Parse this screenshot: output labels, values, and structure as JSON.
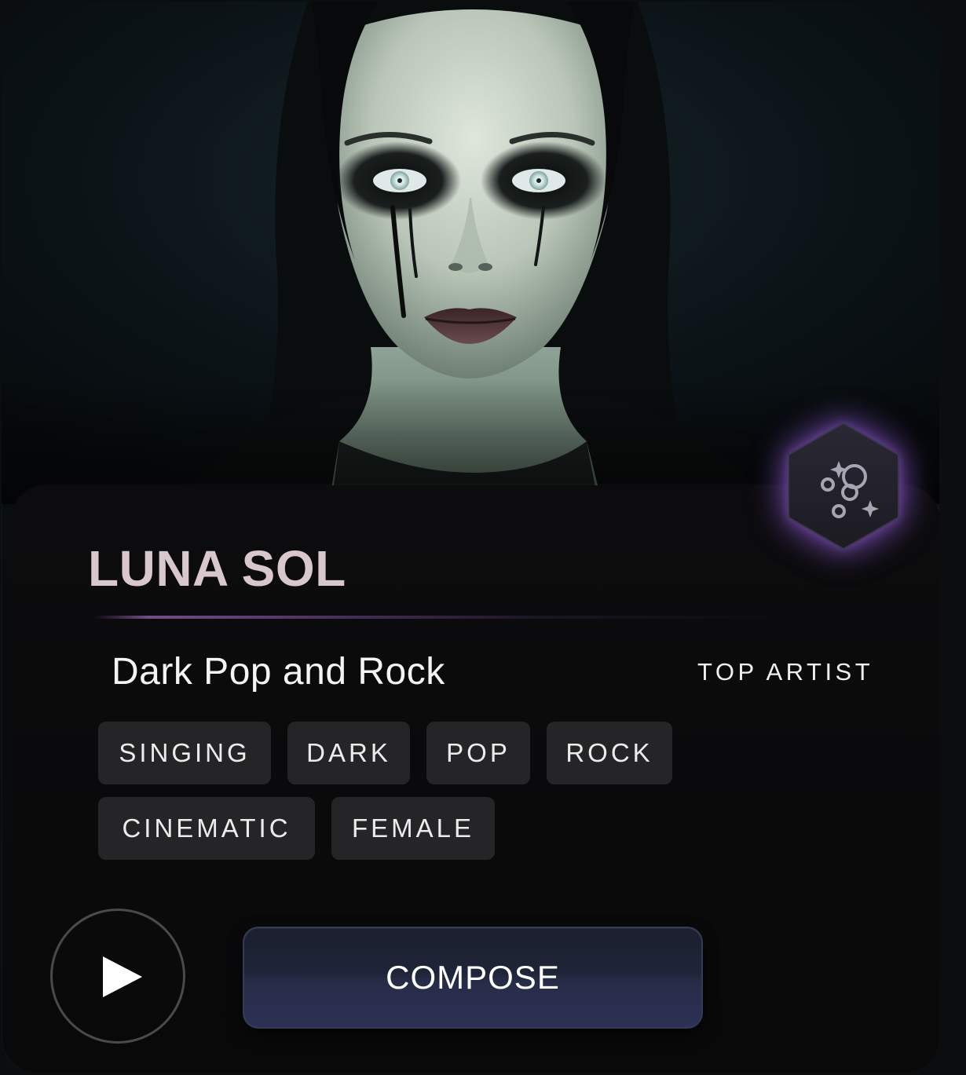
{
  "artist": {
    "name": "LUNA SOL",
    "genre": "Dark Pop and Rock",
    "status_label": "TOP ARTIST"
  },
  "tags": [
    "SINGING",
    "DARK",
    "POP",
    "ROCK",
    "CINEMATIC",
    "FEMALE"
  ],
  "actions": {
    "compose_label": "COMPOSE",
    "play_icon": "play-icon",
    "badge_icon": "ai-sparkle-badge-icon"
  },
  "colors": {
    "background": "#0b0d0f",
    "panel": "#0a0a0b",
    "name_text": "#d8c8cc",
    "accent_glow": "#8e54d6",
    "tag_bg": "#252527",
    "compose_bg": "#272c48"
  }
}
